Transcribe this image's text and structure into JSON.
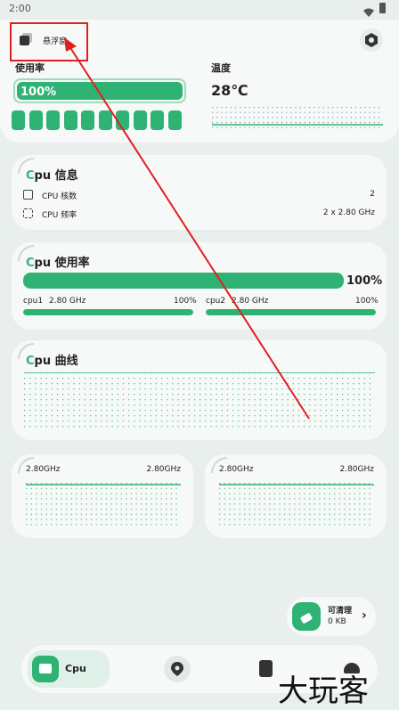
{
  "status": {
    "time": "2:00"
  },
  "floating": {
    "label": "悬浮窗"
  },
  "top": {
    "usage_label": "使用率",
    "usage_value": "100%",
    "usage_fraction": 1.0,
    "temp_label": "温度",
    "temp_value": "28℃"
  },
  "cpu_info": {
    "title_c": "C",
    "title_rest": "pu 信息",
    "rows": [
      {
        "label": "CPU 核数",
        "value": "2"
      },
      {
        "label": "CPU 频率",
        "value": "2 x 2.80 GHz"
      }
    ]
  },
  "cpu_usage": {
    "title_c": "C",
    "title_rest": "pu 使用率",
    "total": "100%",
    "total_fraction": 1.0,
    "cores": [
      {
        "name": "cpu1",
        "freq": "2.80 GHz",
        "pct": "100%",
        "fraction": 1.0
      },
      {
        "name": "cpu2",
        "freq": "2.80 GHz",
        "pct": "100%",
        "fraction": 1.0
      }
    ]
  },
  "cpu_curve": {
    "title_c": "C",
    "title_rest": "pu 曲线"
  },
  "core_charts": [
    {
      "left": "2.80GHz",
      "right": "2.80GHz"
    },
    {
      "left": "2.80GHz",
      "right": "2.80GHz"
    }
  ],
  "cleaner": {
    "title": "可清理",
    "value": "0 KB"
  },
  "nav": {
    "active_label": "Cpu"
  },
  "watermark": "大玩客",
  "colors": {
    "accent": "#2fb374",
    "annotation": "#e02020"
  }
}
